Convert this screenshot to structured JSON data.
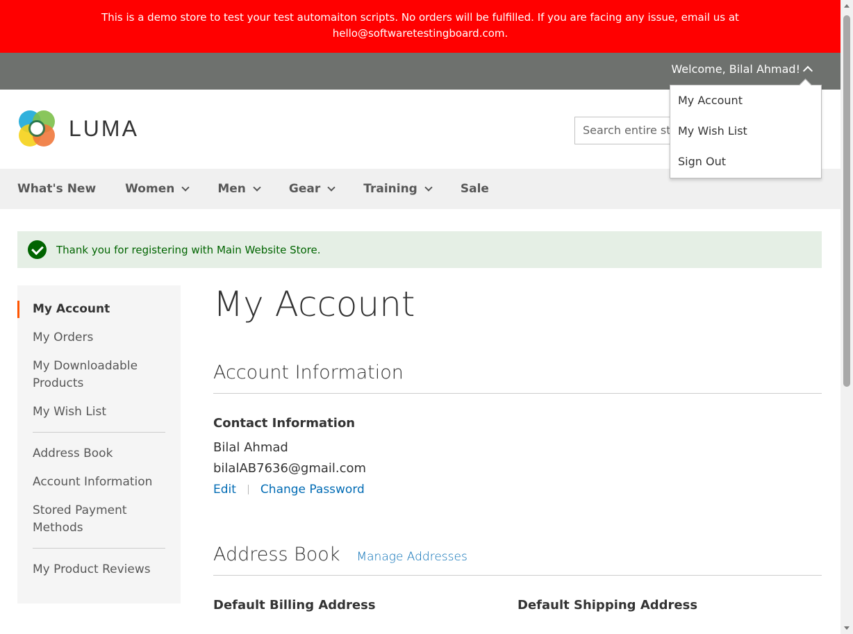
{
  "banner": {
    "line1": "This is a demo store to test your test automaiton scripts. No orders will be fulfilled. If you are facing any issue, email us at",
    "line2": "hello@softwaretestingboard.com."
  },
  "topbar": {
    "welcome": "Welcome, Bilal Ahmad!",
    "dropdown": [
      "My Account",
      "My Wish List",
      "Sign Out"
    ]
  },
  "header": {
    "logo_text": "LUMA",
    "search_placeholder": "Search entire store here..."
  },
  "nav": [
    {
      "label": "What's New",
      "has_dropdown": false
    },
    {
      "label": "Women",
      "has_dropdown": true
    },
    {
      "label": "Men",
      "has_dropdown": true
    },
    {
      "label": "Gear",
      "has_dropdown": true
    },
    {
      "label": "Training",
      "has_dropdown": true
    },
    {
      "label": "Sale",
      "has_dropdown": false
    }
  ],
  "message": "Thank you for registering with Main Website Store.",
  "sidebar": {
    "group1": [
      "My Account",
      "My Orders",
      "My Downloadable Products",
      "My Wish List"
    ],
    "group2": [
      "Address Book",
      "Account Information",
      "Stored Payment Methods"
    ],
    "group3": [
      "My Product Reviews"
    ]
  },
  "main": {
    "title": "My Account",
    "account_info_title": "Account Information",
    "contact_title": "Contact Information",
    "name": "Bilal Ahmad",
    "email": "bilalAB7636@gmail.com",
    "edit_label": "Edit",
    "change_password_label": "Change Password",
    "address_book_title": "Address Book",
    "manage_addresses_label": "Manage Addresses",
    "billing_title": "Default Billing Address",
    "shipping_title": "Default Shipping Address"
  },
  "colors": {
    "banner": "#ff0000",
    "topbar": "#6e716e",
    "link": "#006bb4",
    "success": "#006400",
    "active_marker": "#ff5501"
  }
}
